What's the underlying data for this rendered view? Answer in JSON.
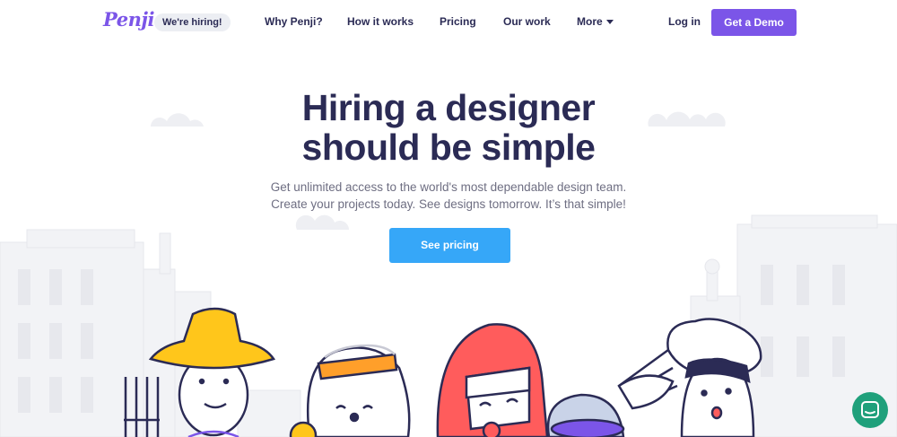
{
  "nav": {
    "logo": "Penji",
    "hiring_badge": "We're hiring!",
    "links": [
      "Why Penji?",
      "How it works",
      "Pricing",
      "Our work",
      "More"
    ],
    "login": "Log in",
    "demo": "Get a Demo"
  },
  "hero": {
    "title_line1": "Hiring a designer",
    "title_line2": "should be simple",
    "subtitle_line1": "Get unlimited access to the world's most dependable design team.",
    "subtitle_line2": "Create your projects today. See designs tomorrow. It’s that simple!",
    "cta": "See pricing"
  },
  "colors": {
    "brand_purple": "#7b55e8",
    "cta_blue": "#36a7f8",
    "heading": "#2b2b55",
    "chat_green": "#1fa07b"
  },
  "icons": {
    "more_dropdown": "chevron-down-icon",
    "chat": "chat-icon"
  }
}
